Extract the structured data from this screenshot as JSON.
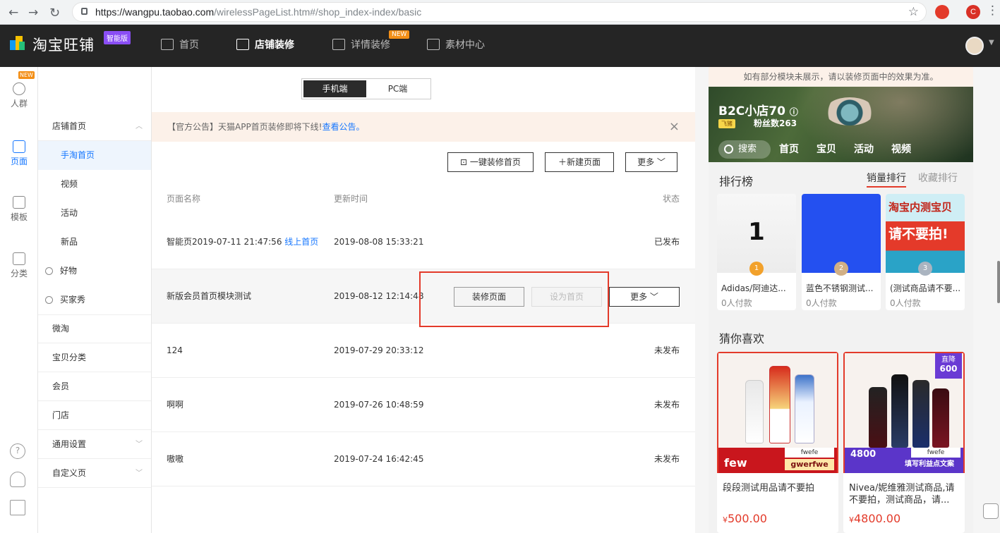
{
  "browser": {
    "url_host": "https://wangpu.taobao.com",
    "url_path": "/wirelessPageList.htm#/shop_index-index/basic",
    "ext1": "",
    "ext2": "C"
  },
  "topnav": {
    "brand": "淘宝旺铺",
    "edition": "智能版",
    "items": [
      {
        "label": "首页"
      },
      {
        "label": "店铺装修"
      },
      {
        "label": "详情装修",
        "tag": "NEW"
      },
      {
        "label": "素材中心"
      }
    ]
  },
  "rail": {
    "items": [
      {
        "label": "人群",
        "tag": "NEW"
      },
      {
        "label": "页面"
      },
      {
        "label": "模板"
      },
      {
        "label": "分类"
      }
    ],
    "bottom": [
      "?",
      "",
      ""
    ]
  },
  "submenu": {
    "items": [
      {
        "label": "店铺首页"
      },
      {
        "label": "手淘首页"
      },
      {
        "label": "视频"
      },
      {
        "label": "活动"
      },
      {
        "label": "新品"
      },
      {
        "label": "好物"
      },
      {
        "label": "买家秀"
      },
      {
        "label": "微淘"
      },
      {
        "label": "宝贝分类"
      },
      {
        "label": "会员"
      },
      {
        "label": "门店"
      },
      {
        "label": "通用设置"
      },
      {
        "label": "自定义页"
      }
    ]
  },
  "main": {
    "toggle": {
      "mobile": "手机端",
      "pc": "PC端"
    },
    "notice": {
      "text": "【官方公告】天猫APP首页装修即将下线!",
      "link": "查看公告。",
      "close": "×"
    },
    "actions": {
      "one_click": "一键装修首页",
      "new_page": "新建页面",
      "more": "更多"
    },
    "columns": {
      "name": "页面名称",
      "updated": "更新时间",
      "status": "状态"
    },
    "rows": [
      {
        "name": "智能页2019-07-11 21:47:56",
        "link": "线上首页",
        "updated": "2019-08-08 15:33:21",
        "status": "已发布"
      },
      {
        "name": "新版会员首页模块测试",
        "updated": "2019-08-12 12:14:48",
        "decorate": "装修页面",
        "set_home": "设为首页",
        "more": "更多"
      },
      {
        "name": "124",
        "updated": "2019-07-29 20:33:12",
        "status": "未发布"
      },
      {
        "name": "啊啊",
        "updated": "2019-07-26 10:48:59",
        "status": "未发布"
      },
      {
        "name": "嗷嗷",
        "updated": "2019-07-24 16:42:45",
        "status": "未发布"
      }
    ]
  },
  "preview": {
    "tip": "如有部分模块未展示，请以装修页面中的效果为准。",
    "shop_name": "B2C小店70",
    "shop_badge": "飞猪",
    "fans": "粉丝数263",
    "search": "搜索",
    "tabs": [
      "首页",
      "宝贝",
      "活动",
      "视频"
    ],
    "ranking": {
      "title": "排行榜",
      "tab_sales": "销量排行",
      "tab_fav": "收藏排行",
      "items": [
        {
          "img_text": "1",
          "medal": "1",
          "name": "Adidas/阿迪达...",
          "sold": "0人付款"
        },
        {
          "img_text": "",
          "medal": "2",
          "name": "蓝色不锈钢测试...",
          "sold": "0人付款"
        },
        {
          "img_text": "淘宝内测宝贝",
          "img_text2": "请不要拍!",
          "medal": "3",
          "name": "(测试商品请不要...",
          "sold": "0人付款"
        }
      ]
    },
    "guess": {
      "title": "猜你喜欢",
      "items": [
        {
          "name": "段段测试用品请不要拍",
          "currency": "¥",
          "price": "500.00",
          "tag1": "fwefe",
          "tag2": "gwerfwe",
          "tag3": "few"
        },
        {
          "name": "Nivea/妮维雅测试商品,请不要拍，测试商品，请...",
          "currency": "¥",
          "price": "4800.00",
          "tag1": "fwefe",
          "tag2": "填写利益点文案",
          "tag3": "4800",
          "corner": "直降",
          "corner2": "600"
        }
      ]
    }
  },
  "colors": {
    "accent": "#1677ff",
    "danger": "#e33a2a",
    "nav_bg": "#252525",
    "new_tag": "#f38f17"
  }
}
